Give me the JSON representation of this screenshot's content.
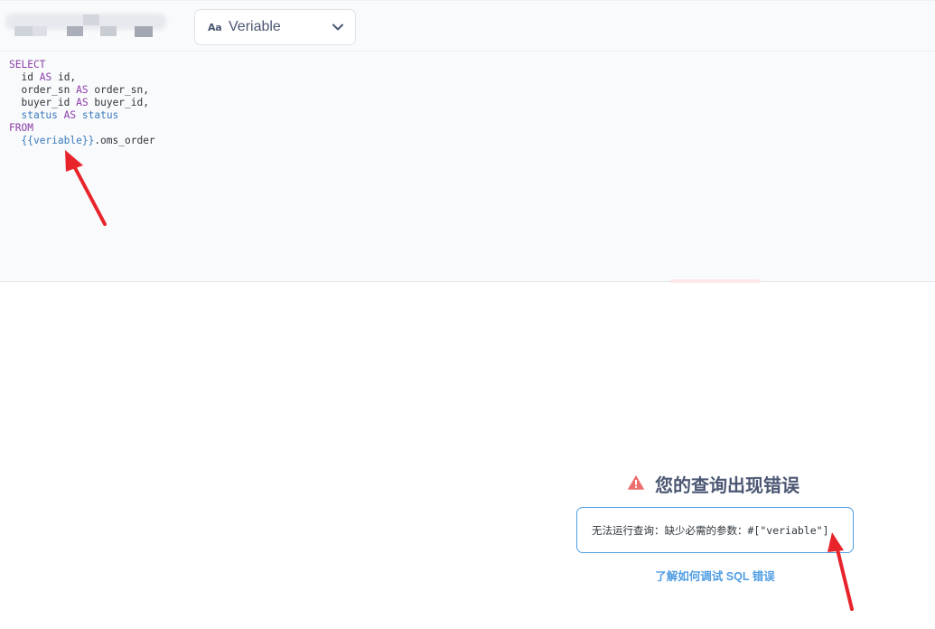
{
  "header": {
    "variable_icon": "Aa",
    "variable_label": "Veriable"
  },
  "editor": {
    "lines": [
      {
        "kw": "SELECT"
      },
      {
        "col": "id",
        "as": "AS",
        "alias": "id,"
      },
      {
        "col": "order_sn",
        "as": "AS",
        "alias": "order_sn,"
      },
      {
        "col": "buyer_id",
        "as": "AS",
        "alias": "buyer_id,"
      },
      {
        "col": "status",
        "as": "AS",
        "alias": "status"
      },
      {
        "kw": "FROM"
      },
      {
        "tmpl": "{{veriable}}",
        "rest": ".oms_order"
      }
    ]
  },
  "error": {
    "heading": "您的查询出现错误",
    "message": "无法运行查询：缺少必需的参数：#[\"veriable\"]",
    "help_link": "了解如何调试 SQL 错误"
  },
  "colors": {
    "accent": "#509ee3",
    "error_icon": "#ed6e6e",
    "annotation_arrow": "#e8242b"
  }
}
